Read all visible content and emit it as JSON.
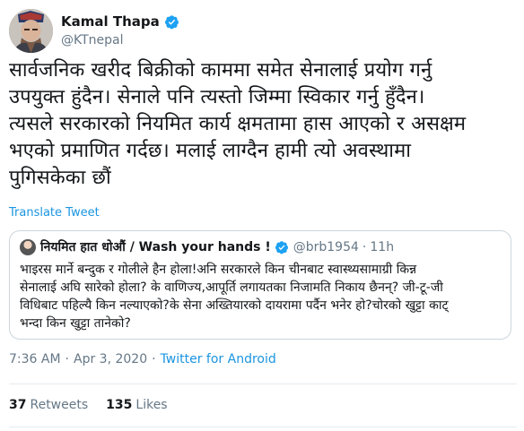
{
  "author": {
    "display_name": "Kamal Thapa",
    "handle": "@KTnepal",
    "verified": true,
    "avatar": "avatar-photo"
  },
  "tweet": {
    "text": "सार्वजनिक खरीद बिक्रीको काममा समेत सेनालाई प्रयोग गर्नु\nउपयुक्त हुंदैन। सेनाले पनि त्यस्तो जिम्मा स्विकार गर्नु हुँदैन।\nत्यसले सरकारको नियमित कार्य क्षमतामा हास आएको र असक्षम\nभएको प्रमाणित गर्दछ। मलाई लाग्दैन हामी त्यो अवस्थामा\nपुगिसकेका छौं",
    "translate_label": "Translate Tweet"
  },
  "quoted": {
    "name": "नियमित हात धोऔं / Wash your hands !",
    "verified": true,
    "handle": "@brb1954",
    "separator": "·",
    "time": "11h",
    "text": "भाइरस मार्ने बन्दुक र गोलीले हैन होला!अनि सरकारले किन चीनबाट स्वास्थ्यसामाग्री किन्न\nसेनालाई अघि सारेको होला? के वाणिज्य,आपूर्ति लगायतका निजामति निकाय छैनन्? जी-टू-जी\nविधिबाट पहिल्यै किन नल्याएको?के सेना अख्तियारको दायरामा पर्दैन भनेर हो?चोरको खुट्टा काट्\nभन्दा किन खुट्टा तानेको?"
  },
  "meta": {
    "time": "7:36 AM",
    "dot1": "·",
    "date": "Apr 3, 2020",
    "dot2": "·",
    "source": "Twitter for Android"
  },
  "stats": {
    "retweets_count": "37",
    "retweets_label": "Retweets",
    "likes_count": "135",
    "likes_label": "Likes"
  },
  "colors": {
    "link": "#1b95e0",
    "secondary_text": "#657786",
    "border": "#ccd6dd",
    "verified_badge": "#1da1f2"
  }
}
